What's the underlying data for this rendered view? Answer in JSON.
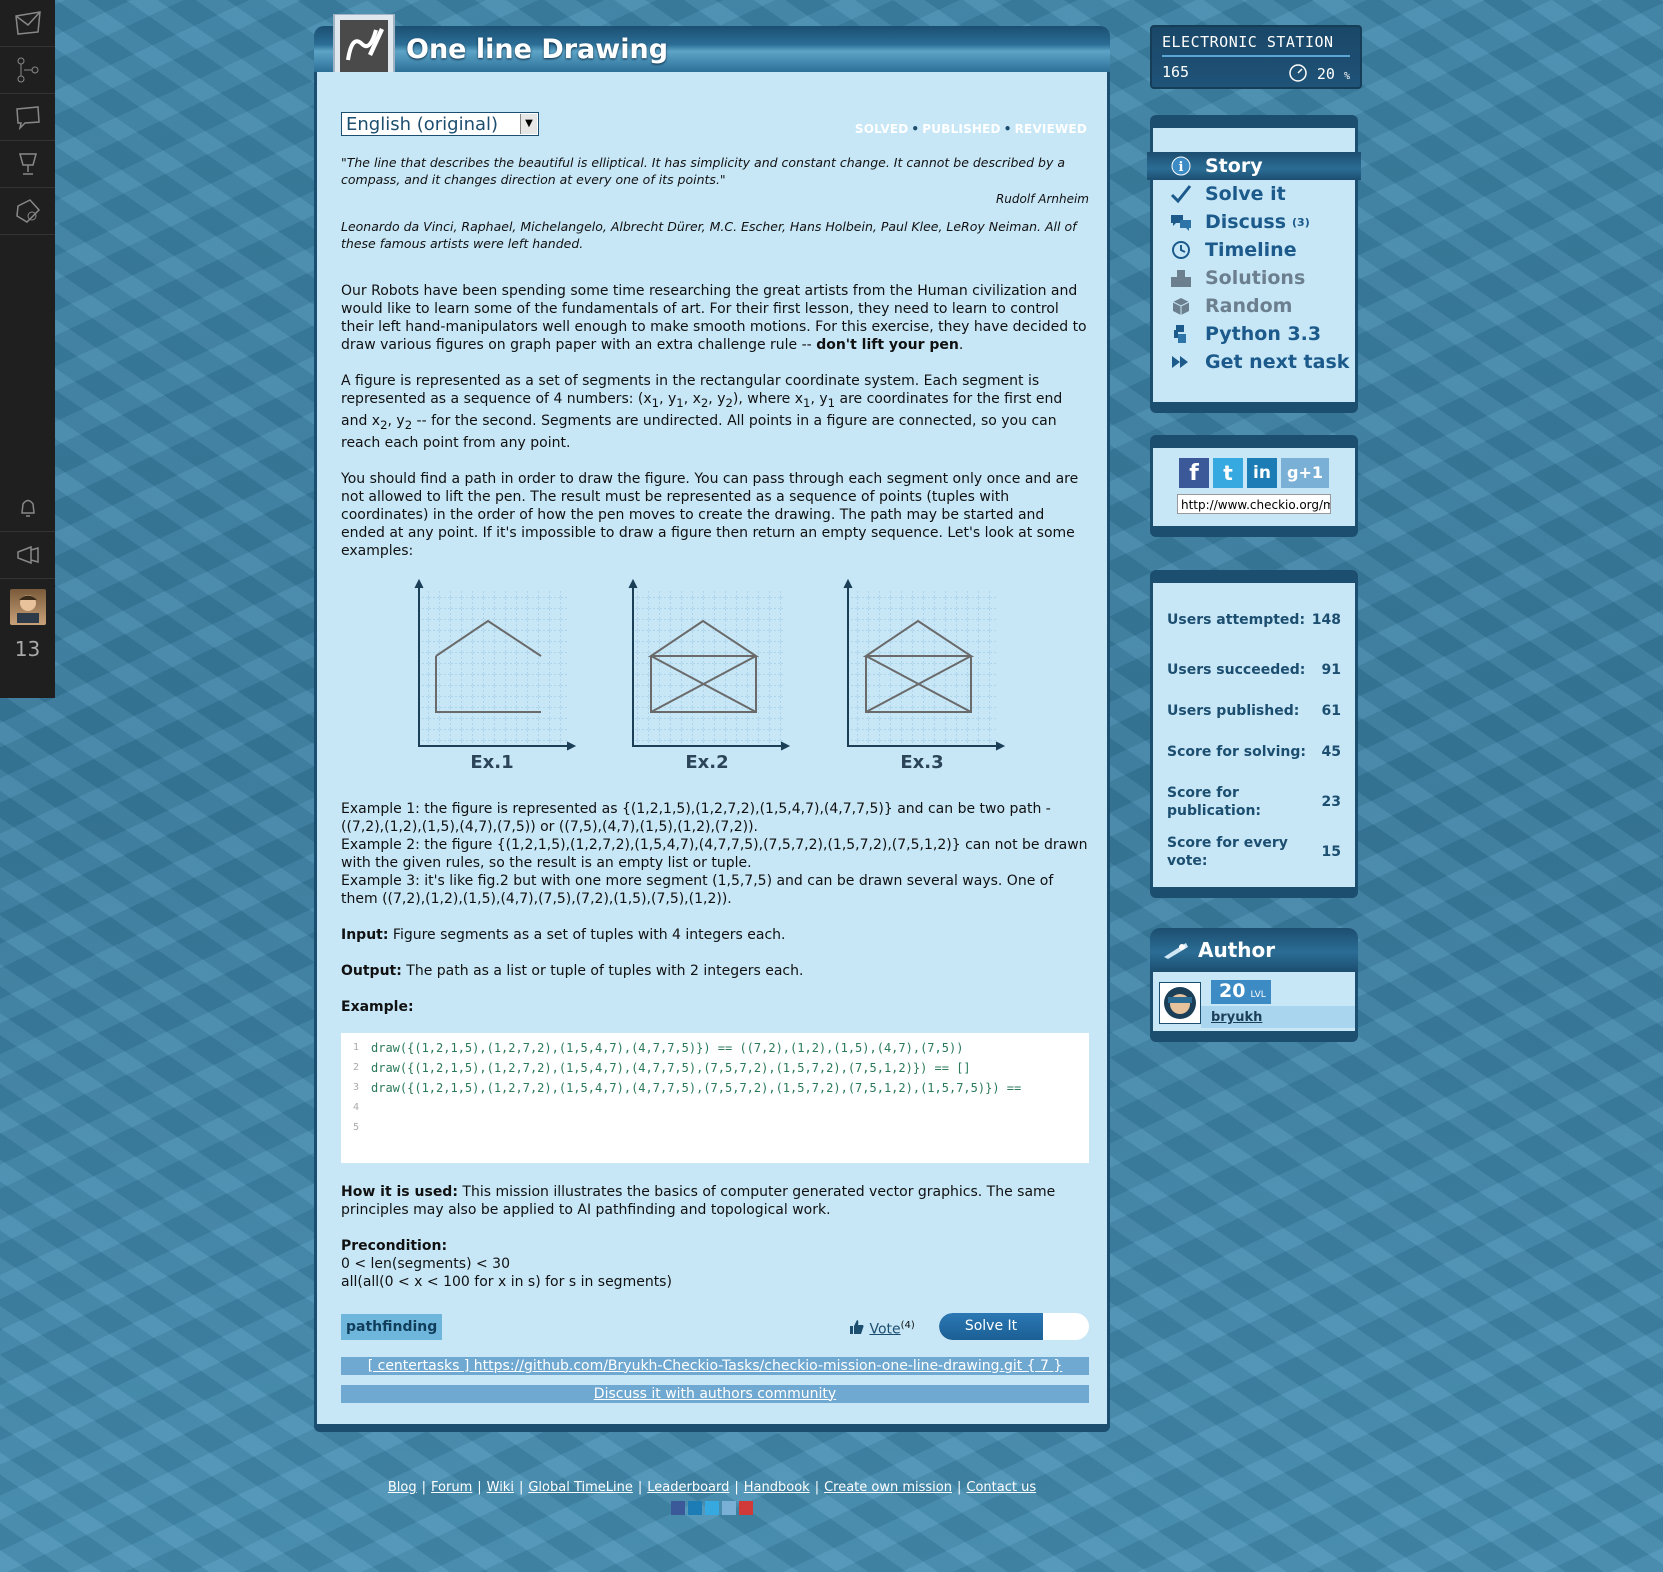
{
  "main": {
    "title": "One line Drawing",
    "language": "English (original)",
    "status": [
      "SOLVED",
      "PUBLISHED",
      "REVIEWED"
    ],
    "quote": "\"The line that describes the beautiful is elliptical. It has simplicity and constant change. It cannot be described by a compass, and it changes direction at every one of its points.\"",
    "quote_author": "Rudolf Arnheim",
    "artists": "Leonardo da Vinci, Raphael, Michelangelo, Albrecht Dürer, M.C. Escher, Hans Holbein, Paul Klee, LeRoy Neiman. All of these famous artists were left handed.",
    "intro": "Our Robots have been spending some time researching the great artists from the Human civilization and would like to learn some of the fundamentals of art. For their first lesson, they need to learn to control their left hand-manipulators well enough to make smooth motions. For this exercise, they have decided to draw various figures on graph paper with an extra challenge rule --",
    "intro_bold": "don't lift your pen",
    "intro_end": ".",
    "figure_p1": "A figure is represented as a set of segments in the rectangular coordinate system. Each segment is represented as a sequence of 4 numbers: (x",
    "figure_p2": "), where x",
    "figure_p3": " are coordinates for the first end and x",
    "figure_p4": " -- for the second. Segments are undirected. All points in a figure are connected, so you can reach each point from any point.",
    "path_para": "You should find a path in order to draw the figure. You can pass through each segment only once and are not allowed to lift the pen. The result must be represented as a sequence of points (tuples with coordinates) in the order of how the pen moves to create the drawing. The path may be started and ended at any point. If it's impossible to draw a figure then return an empty sequence. Let's look at some examples:",
    "figure_labels": [
      "Ex.1",
      "Ex.2",
      "Ex.3"
    ],
    "example1": "Example 1: the figure is represented as {(1,2,1,5),(1,2,7,2),(1,5,4,7),(4,7,7,5)} and can be two path - ((7,2),(1,2),(1,5),(4,7),(7,5)) or ((7,5),(4,7),(1,5),(1,2),(7,2)).",
    "example2": "Example 2: the figure {(1,2,1,5),(1,2,7,2),(1,5,4,7),(4,7,7,5),(7,5,7,2),(1,5,7,2),(7,5,1,2)} can not be drawn with the given rules, so the result is an empty list or tuple.",
    "example3": "Example 3: it's like fig.2 but with one more segment (1,5,7,5) and can be drawn several ways. One of them ((7,2),(1,2),(1,5),(4,7),(7,5),(7,2),(1,5),(7,5),(1,2)).",
    "input_label": "Input:",
    "input_text": "Figure segments as a set of tuples with 4 integers each.",
    "output_label": "Output:",
    "output_text": "The path as a list or tuple of tuples with 2 integers each.",
    "example_label": "Example:",
    "code_lines": [
      {
        "n": "1",
        "text": "draw({(1,2,1,5),(1,2,7,2),(1,5,4,7),(4,7,7,5)}) == ((7,2),(1,2),(1,5),(4,7),(7,5))"
      },
      {
        "n": "2",
        "text": "draw({(1,2,1,5),(1,2,7,2),(1,5,4,7),(4,7,7,5),(7,5,7,2),(1,5,7,2),(7,5,1,2)}) == []"
      },
      {
        "n": "3",
        "text": "draw({(1,2,1,5),(1,2,7,2),(1,5,4,7),(4,7,7,5),(7,5,7,2),(1,5,7,2),(7,5,1,2),(1,5,7,5)}) =="
      },
      {
        "n": "4",
        "text": ""
      },
      {
        "n": "5",
        "text": ""
      }
    ],
    "how_label": "How it is used:",
    "how_text": "This mission illustrates the basics of computer generated vector graphics. The same principles may also be applied to AI pathfinding and topological work.",
    "precondition_label": "Precondition:",
    "precondition_1": "0 < len(segments) < 30",
    "precondition_2": "all(all(0 < x < 100 for x in s) for s in segments)",
    "tag": "pathfinding",
    "vote_label": "Vote",
    "vote_count": "(4)",
    "solve_label": "Solve It",
    "repo_link": "[ centertasks ] https://github.com/Bryukh-Checkio-Tasks/checkio-mission-one-line-drawing.git { 7 }",
    "discuss_link": "Discuss it with authors community"
  },
  "station": {
    "title": "ELECTRONIC STATION",
    "count": "165",
    "percent": "20",
    "percent_unit": "%"
  },
  "menu": [
    {
      "label": "Story",
      "icon": "info-icon",
      "state": "active"
    },
    {
      "label": "Solve it",
      "icon": "checkmark-icon",
      "state": "normal"
    },
    {
      "label": "Discuss",
      "sub": "(3)",
      "icon": "discuss-icon",
      "state": "normal"
    },
    {
      "label": "Timeline",
      "icon": "clock-icon",
      "state": "normal"
    },
    {
      "label": "Solutions",
      "icon": "solutions-icon",
      "state": "muted"
    },
    {
      "label": "Random",
      "icon": "dice-icon",
      "state": "muted"
    },
    {
      "label": "Python 3.3",
      "icon": "python-icon",
      "state": "normal"
    },
    {
      "label": "Get next task",
      "icon": "arrow-next-icon",
      "state": "normal"
    }
  ],
  "share": {
    "url": "http://www.checkio.org/mission/one-line-drawing/"
  },
  "stats": [
    {
      "label": "Users attempted:",
      "value": "148"
    },
    {
      "label": "Users succeeded:",
      "value": "91"
    },
    {
      "label": "Users published:",
      "value": "61"
    },
    {
      "label": "Score for solving:",
      "value": "45"
    },
    {
      "label": "Score for publication:",
      "value": "23"
    },
    {
      "label": "Score for every vote:",
      "value": "15"
    }
  ],
  "author": {
    "header": "Author",
    "level": "20",
    "level_unit": "LVL",
    "name": "bryukh"
  },
  "sidebar_level": "13",
  "footer": {
    "links": [
      "Blog",
      "Forum",
      "Wiki",
      "Global TimeLine",
      "Leaderboard",
      "Handbook",
      "Create own mission",
      "Contact us"
    ]
  },
  "colors": {
    "panel_bg": "#c7e7f7",
    "panel_border": "#1c4e70",
    "menu_text": "#1b5a8a",
    "background": "#3f87ab"
  }
}
